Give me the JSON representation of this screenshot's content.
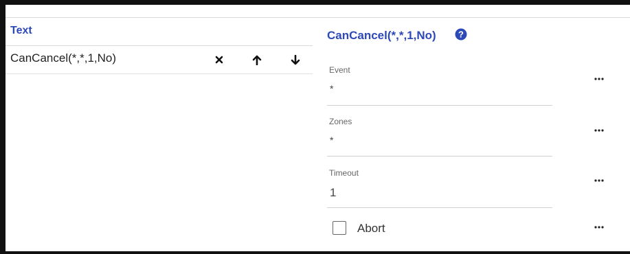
{
  "list_panel": {
    "header": "Text",
    "rows": [
      {
        "label": "CanCancel(*,*,1,No)"
      }
    ]
  },
  "detail_panel": {
    "title": "CanCancel(*,*,1,No)",
    "help_icon": "question-circle-icon",
    "fields": {
      "event": {
        "label": "Event",
        "value": "*"
      },
      "zones": {
        "label": "Zones",
        "value": "*"
      },
      "timeout": {
        "label": "Timeout",
        "value": "1"
      }
    },
    "abort": {
      "label": "Abort",
      "checked": false
    }
  },
  "colors": {
    "accent": "#2d49b7"
  },
  "icons": {
    "delete": "close-icon",
    "move_up": "arrow-up-icon",
    "move_down": "arrow-down-icon",
    "more": "ellipsis-icon"
  }
}
